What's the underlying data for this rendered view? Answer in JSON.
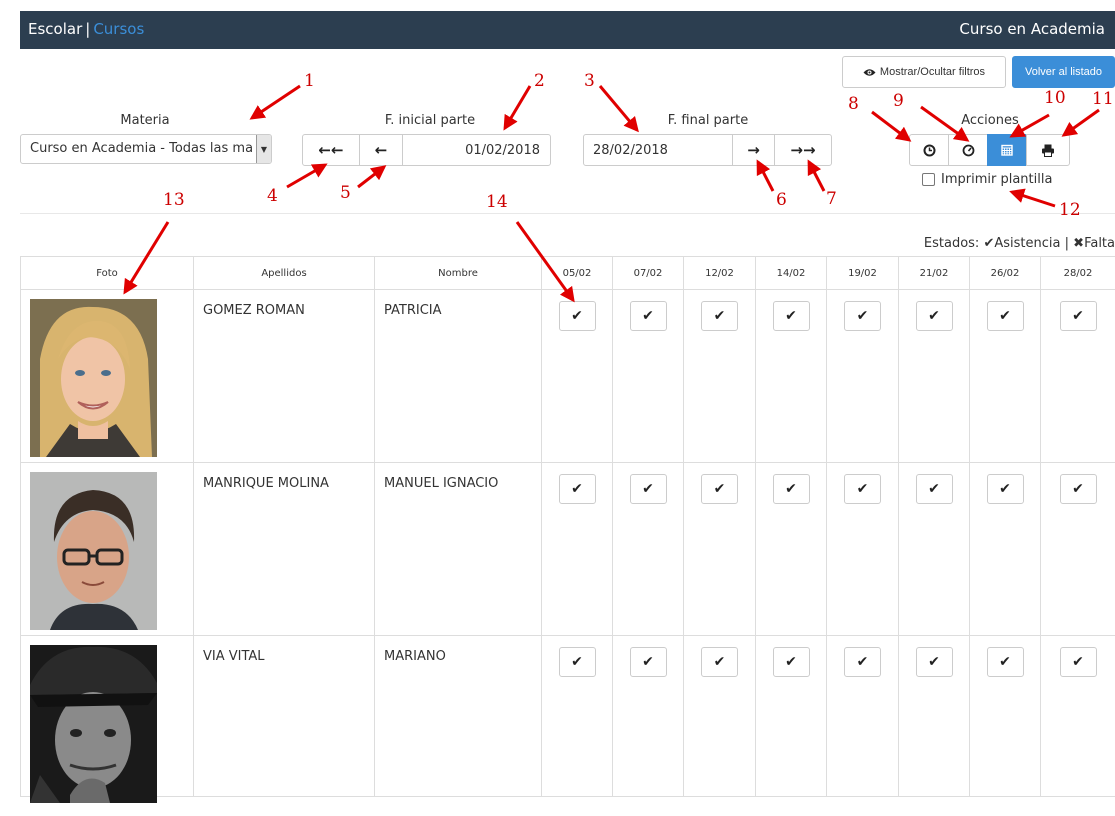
{
  "topbar": {
    "brand": "Escolar",
    "separator": "|",
    "section": "Cursos",
    "page_title": "Curso en Academia"
  },
  "actions_top": {
    "filters_label": "Mostrar/Ocultar filtros",
    "back_label": "Volver al listado"
  },
  "filters": {
    "materia_label": "Materia",
    "materia_value": "Curso en Academia - Todas las materias",
    "start_label": "F. inicial parte",
    "start_value": "01/02/2018",
    "end_label": "F. final parte",
    "end_value": "28/02/2018",
    "acciones_label": "Acciones",
    "print_template_label": "Imprimir plantilla"
  },
  "states": {
    "prefix": "Estados:",
    "present": "Asistencia",
    "sep": "|",
    "absent": "Falta"
  },
  "table": {
    "headers": [
      "Foto",
      "Apellidos",
      "Nombre",
      "05/02",
      "07/02",
      "12/02",
      "14/02",
      "19/02",
      "21/02",
      "26/02",
      "28/02"
    ],
    "rows": [
      {
        "apellidos": "GOMEZ ROMAN",
        "nombre": "PATRICIA",
        "marks": [
          "✔",
          "✔",
          "✔",
          "✔",
          "✔",
          "✔",
          "✔",
          "✔"
        ]
      },
      {
        "apellidos": "MANRIQUE MOLINA",
        "nombre": "MANUEL IGNACIO",
        "marks": [
          "✔",
          "✔",
          "✔",
          "✔",
          "✔",
          "✔",
          "✔",
          "✔"
        ]
      },
      {
        "apellidos": "VIA VITAL",
        "nombre": "MARIANO",
        "marks": [
          "✔",
          "✔",
          "✔",
          "✔",
          "✔",
          "✔",
          "✔",
          "✔"
        ]
      }
    ]
  },
  "annotations": [
    "1",
    "2",
    "3",
    "4",
    "5",
    "6",
    "7",
    "8",
    "9",
    "10",
    "11",
    "12",
    "13",
    "14"
  ],
  "icons": {
    "double_left": "←←",
    "left": "←",
    "right": "→",
    "double_right": "→→",
    "check": "✔",
    "cross": "✖",
    "dropdown_caret": "▼"
  },
  "colors": {
    "topbar": "#2c3e50",
    "accent": "#3b8ed8",
    "annotation": "#cc0000"
  }
}
